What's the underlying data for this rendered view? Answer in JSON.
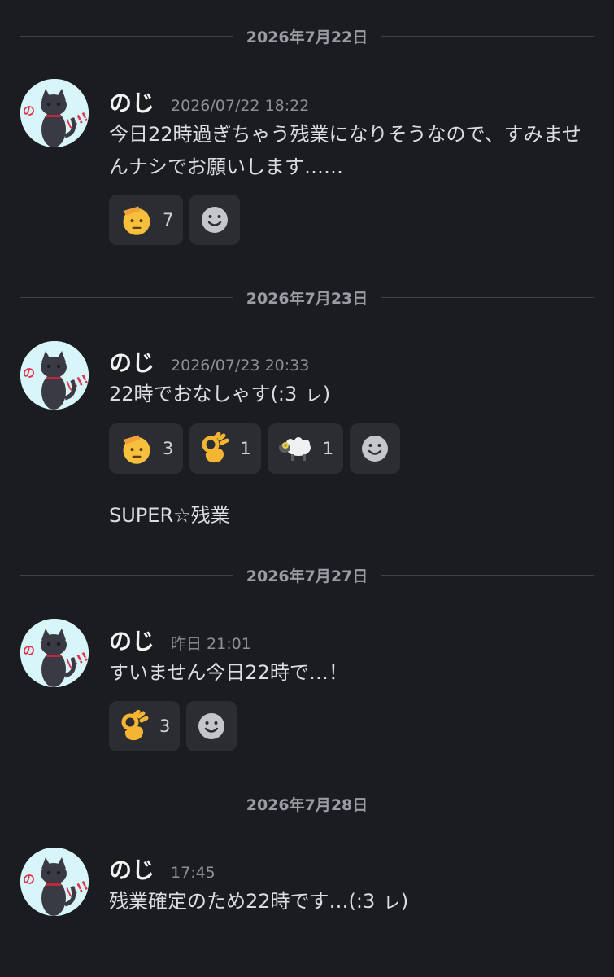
{
  "messages": [
    {
      "date": "2026年7月22日",
      "username": "のじ",
      "timestamp": "2026/07/22 18:22",
      "text": "今日22時過ぎちゃう残業になりそうなので、すみませんナシでお願いします……",
      "reactions": [
        {
          "icon": "saluting-face-icon",
          "count": "7"
        }
      ]
    },
    {
      "date": "2026年7月23日",
      "username": "のじ",
      "timestamp": "2026/07/23 20:33",
      "text": "22時でおなしゃす(:3 ㇾ)",
      "reactions": [
        {
          "icon": "saluting-face-icon",
          "count": "3"
        },
        {
          "icon": "ok-hand-icon",
          "count": "1"
        },
        {
          "icon": "sheep-icon",
          "count": "1"
        }
      ],
      "followup": "SUPER☆残業"
    },
    {
      "date": "2026年7月27日",
      "username": "のじ",
      "timestamp": "昨日 21:01",
      "text": "すいません今日22時で…！",
      "reactions": [
        {
          "icon": "ok-hand-icon",
          "count": "3"
        }
      ]
    },
    {
      "date": "2026年7月28日",
      "username": "のじ",
      "timestamp": "17:45",
      "text": "残業確定のため22時です…(:3 ㇾ)"
    }
  ],
  "colors": {
    "background": "#1b1c20",
    "reaction_bg": "#2b2d33",
    "divider": "#3f4147",
    "avatar_bg": "#d8f6fa",
    "avatar_text": "#e0344a"
  }
}
